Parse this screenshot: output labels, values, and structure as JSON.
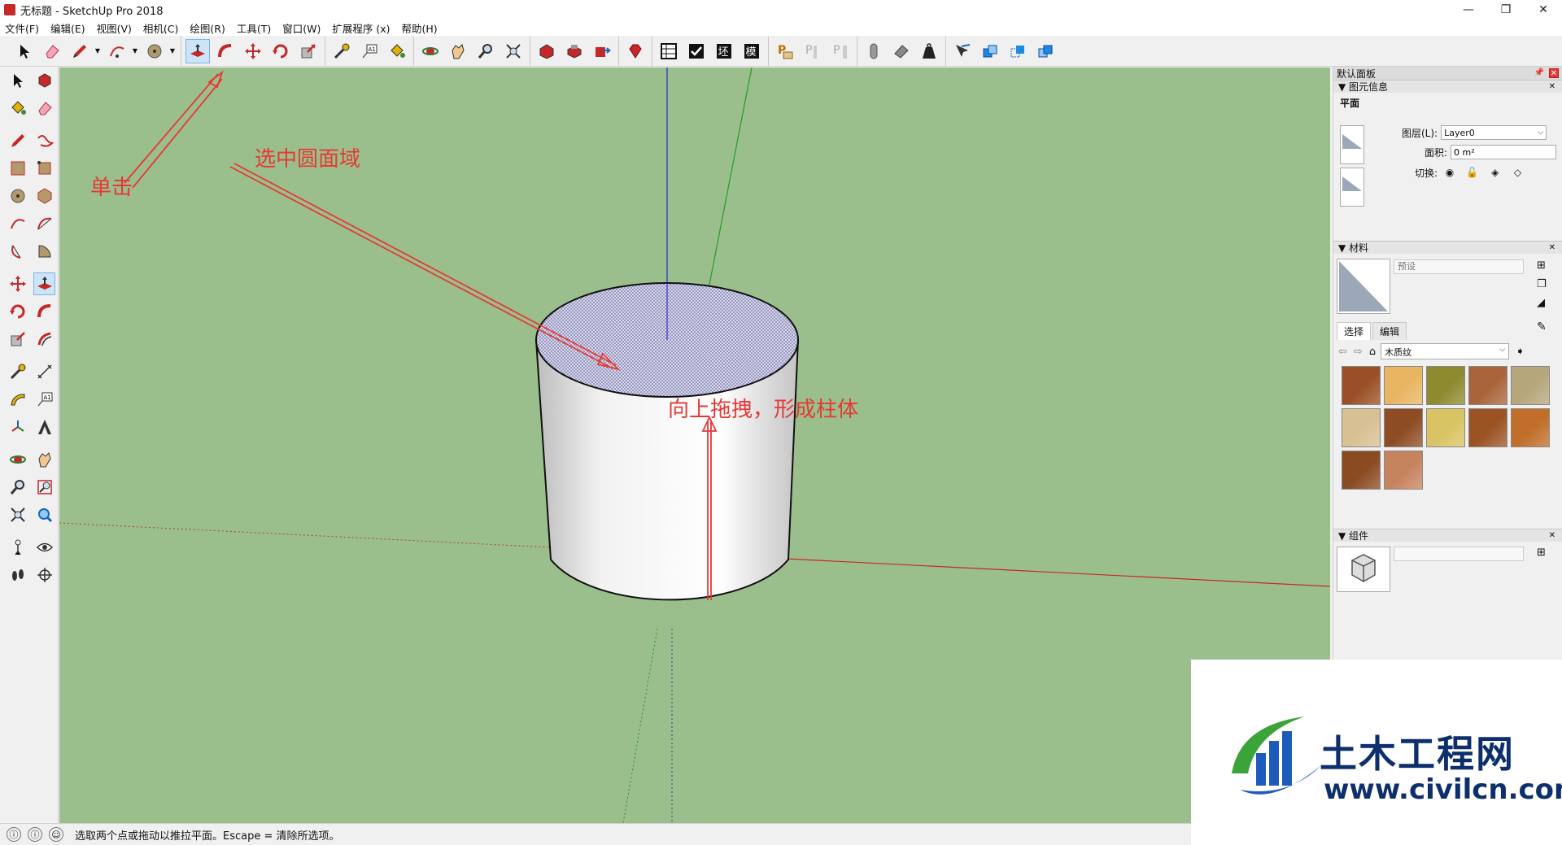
{
  "window": {
    "title": "无标题 - SketchUp Pro 2018",
    "controls": [
      "—",
      "❐",
      "✕"
    ]
  },
  "menu": [
    "文件(F)",
    "编辑(E)",
    "视图(V)",
    "相机(C)",
    "绘图(R)",
    "工具(T)",
    "窗口(W)",
    "扩展程序 (x)",
    "帮助(H)"
  ],
  "toolbar": {
    "icons": [
      "select-icon",
      "eraser-icon",
      "pencil-icon",
      "arc-icon",
      "circle-icon",
      "push-pull-icon",
      "follow-me-icon",
      "move-icon",
      "rotate-icon",
      "scale-icon",
      "tape-measure-icon",
      "text-icon",
      "paint-bucket-icon",
      "orbit-icon",
      "pan-icon",
      "zoom-icon",
      "zoom-extents-icon",
      "warehouse-icon",
      "extension-warehouse-icon",
      "share-model-icon",
      "ruby-icon",
      "table-icon",
      "check-icon",
      "section-icon",
      "model-icon",
      "layout-icon",
      "sandbox-icon",
      "sandbox-2-icon",
      "sandbox-3-icon",
      "solid-icon",
      "eraser-2-icon",
      "weight-icon",
      "intersect-icon",
      "union-icon",
      "subtract-icon",
      "trim-icon"
    ],
    "active": "push-pull-icon",
    "text_labels": {
      "table": "",
      "section": "坯",
      "model": "模"
    }
  },
  "viewport": {
    "background": "#9bbf8c",
    "annotations": {
      "click": "单击",
      "select_circle": "选中圆面域",
      "drag_up": "向上拖拽，形成柱体"
    },
    "annotation_color": "#e53935"
  },
  "panel": {
    "title": "默认面板",
    "entity_info": {
      "header": "▼ 图元信息",
      "type": "平面",
      "layer_label": "图层(L):",
      "layer_value": "Layer0",
      "area_label": "面积:",
      "area_value": "0 m²",
      "toggle_label": "切换:"
    },
    "materials": {
      "header": "▼ 材料",
      "name_placeholder": "预设",
      "tab_select": "选择",
      "tab_edit": "编辑",
      "library": "木质纹",
      "swatches": [
        "#9a4f26",
        "#e8b562",
        "#8e8a30",
        "#a8643a",
        "#b5a67c",
        "#d7c094",
        "#8e4c24",
        "#d9c463",
        "#9b5324",
        "#c06e2a",
        "#8a4a22",
        "#c7825e"
      ]
    },
    "components": {
      "header": "▼ 组件"
    }
  },
  "watermark": {
    "brand": "土木工程网",
    "url": "www.civilcn.com"
  },
  "status": {
    "message": "选取两个点或拖动以推拉平面。Escape = 清除所选项。",
    "icons": [
      "geo-icon",
      "info-icon",
      "user-icon"
    ]
  }
}
